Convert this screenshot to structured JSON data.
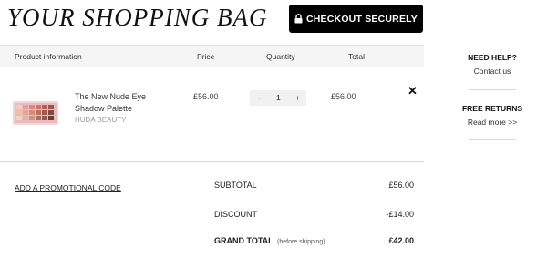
{
  "header": {
    "title": "YOUR SHOPPING BAG",
    "checkout_label": "CHECKOUT SECURELY"
  },
  "table": {
    "columns": [
      "Product information",
      "Price",
      "Quantity",
      "Total"
    ]
  },
  "item": {
    "name": "The New Nude Eye Shadow Palette",
    "brand": "HUDA BEAUTY",
    "price": "£56.00",
    "quantity": "1",
    "minus": "-",
    "plus": "+",
    "total": "£56.00",
    "remove": "✕"
  },
  "promo": {
    "label": "ADD A PROMOTIONAL CODE"
  },
  "summary": {
    "subtotal_label": "SUBTOTAL",
    "subtotal_value": "£56.00",
    "discount_label": "DISCOUNT",
    "discount_value": "-£14.00",
    "grand_label": "GRAND TOTAL",
    "grand_note": "(before shipping)",
    "grand_value": "£42.00"
  },
  "sidebar": {
    "help_title": "NEED HELP?",
    "help_link": "Contact us",
    "returns_title": "FREE RETURNS",
    "returns_link": "Read more >>"
  },
  "colors": {
    "button_bg": "#000000",
    "header_bg": "#f5f5f5",
    "divider": "#d9d9d9"
  }
}
